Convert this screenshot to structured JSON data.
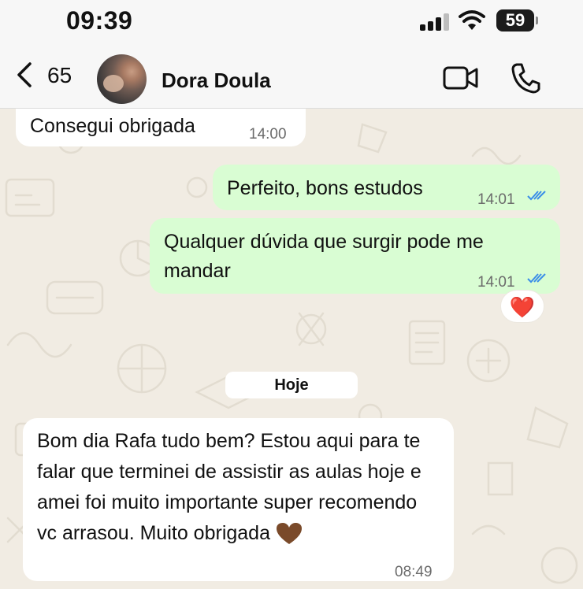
{
  "status_bar": {
    "time": "09:39",
    "battery": "59"
  },
  "header": {
    "back_count": "65",
    "contact_name": "Dora Doula",
    "icons": [
      "chevron-left-icon",
      "avatar",
      "video-call-icon",
      "phone-icon"
    ]
  },
  "messages": [
    {
      "direction": "incoming",
      "text": "Consegui obrigada",
      "time": "14:00"
    },
    {
      "direction": "outgoing",
      "text": "Perfeito, bons estudos",
      "time": "14:01",
      "status": "read"
    },
    {
      "direction": "outgoing",
      "text": "Qualquer dúvida que surgir pode me mandar",
      "time": "14:01",
      "status": "read",
      "reaction": "❤️"
    },
    {
      "direction": "incoming",
      "text": "Bom dia Rafa tudo bem? Estou aqui para te falar que terminei de assistir as aulas hoje e amei foi muito importante super recomendo vc arrasou. Muito obrigada",
      "emoji": "brown-heart",
      "time": "08:49"
    }
  ],
  "date_separator": "Hoje",
  "colors": {
    "outgoing_bubble": "#d9fdd3",
    "incoming_bubble": "#ffffff",
    "read_ticks": "#3b8ee8",
    "background": "#f1ece3"
  }
}
